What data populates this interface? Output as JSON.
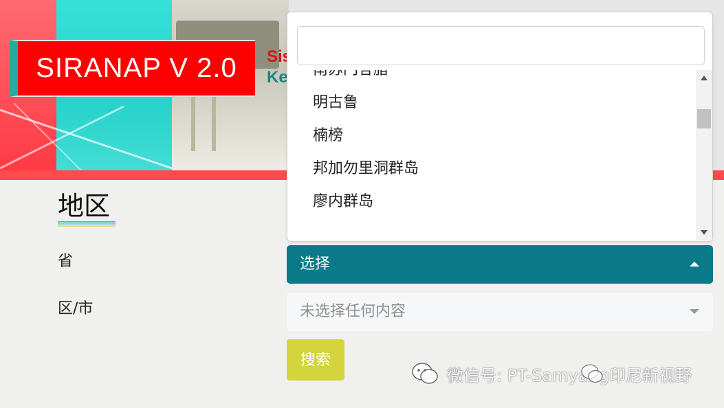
{
  "banner": {
    "logo_text": "SIRANAP V 2.0",
    "subtitle_line1": "Sis",
    "subtitle_line2": "Ke"
  },
  "form": {
    "section_title": "地区",
    "province_label": "省",
    "city_label": "区/市"
  },
  "dropdown": {
    "search_value": "",
    "options": [
      "南苏门答腊",
      "明古鲁",
      "楠榜",
      "邦加勿里洞群岛",
      "廖内群岛"
    ]
  },
  "province_select": {
    "value": "选择",
    "color": "#0b7a88"
  },
  "city_select": {
    "placeholder": "未选择任何内容"
  },
  "search_button": {
    "label": "搜索",
    "color": "#d4d43c"
  },
  "watermark": {
    "text": "微信号: PT-Samyang印尼新视野"
  }
}
